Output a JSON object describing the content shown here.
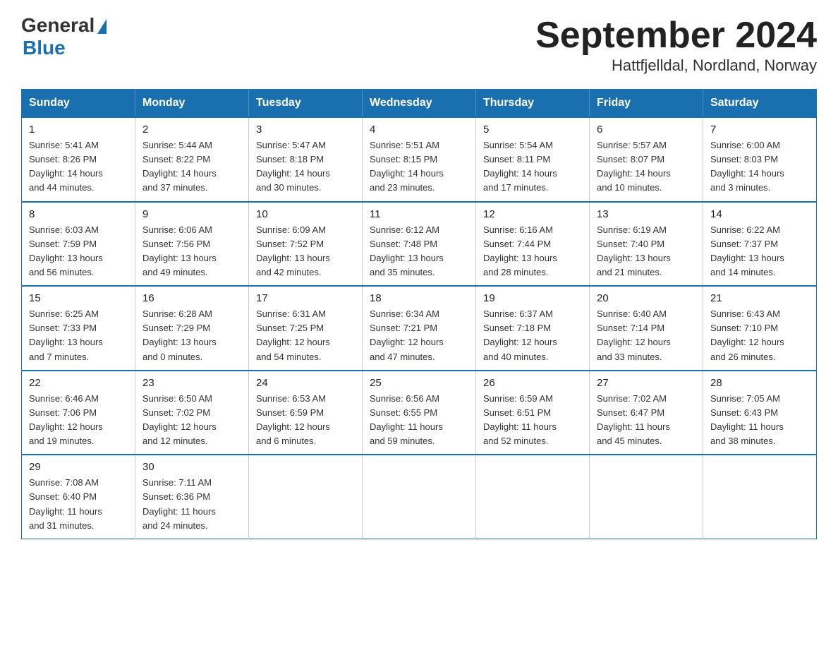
{
  "logo": {
    "general": "General",
    "blue": "Blue",
    "arrow": "▶"
  },
  "title": "September 2024",
  "subtitle": "Hattfjelldal, Nordland, Norway",
  "days_of_week": [
    "Sunday",
    "Monday",
    "Tuesday",
    "Wednesday",
    "Thursday",
    "Friday",
    "Saturday"
  ],
  "weeks": [
    [
      {
        "day": "1",
        "sunrise": "5:41 AM",
        "sunset": "8:26 PM",
        "daylight": "14 hours and 44 minutes."
      },
      {
        "day": "2",
        "sunrise": "5:44 AM",
        "sunset": "8:22 PM",
        "daylight": "14 hours and 37 minutes."
      },
      {
        "day": "3",
        "sunrise": "5:47 AM",
        "sunset": "8:18 PM",
        "daylight": "14 hours and 30 minutes."
      },
      {
        "day": "4",
        "sunrise": "5:51 AM",
        "sunset": "8:15 PM",
        "daylight": "14 hours and 23 minutes."
      },
      {
        "day": "5",
        "sunrise": "5:54 AM",
        "sunset": "8:11 PM",
        "daylight": "14 hours and 17 minutes."
      },
      {
        "day": "6",
        "sunrise": "5:57 AM",
        "sunset": "8:07 PM",
        "daylight": "14 hours and 10 minutes."
      },
      {
        "day": "7",
        "sunrise": "6:00 AM",
        "sunset": "8:03 PM",
        "daylight": "14 hours and 3 minutes."
      }
    ],
    [
      {
        "day": "8",
        "sunrise": "6:03 AM",
        "sunset": "7:59 PM",
        "daylight": "13 hours and 56 minutes."
      },
      {
        "day": "9",
        "sunrise": "6:06 AM",
        "sunset": "7:56 PM",
        "daylight": "13 hours and 49 minutes."
      },
      {
        "day": "10",
        "sunrise": "6:09 AM",
        "sunset": "7:52 PM",
        "daylight": "13 hours and 42 minutes."
      },
      {
        "day": "11",
        "sunrise": "6:12 AM",
        "sunset": "7:48 PM",
        "daylight": "13 hours and 35 minutes."
      },
      {
        "day": "12",
        "sunrise": "6:16 AM",
        "sunset": "7:44 PM",
        "daylight": "13 hours and 28 minutes."
      },
      {
        "day": "13",
        "sunrise": "6:19 AM",
        "sunset": "7:40 PM",
        "daylight": "13 hours and 21 minutes."
      },
      {
        "day": "14",
        "sunrise": "6:22 AM",
        "sunset": "7:37 PM",
        "daylight": "13 hours and 14 minutes."
      }
    ],
    [
      {
        "day": "15",
        "sunrise": "6:25 AM",
        "sunset": "7:33 PM",
        "daylight": "13 hours and 7 minutes."
      },
      {
        "day": "16",
        "sunrise": "6:28 AM",
        "sunset": "7:29 PM",
        "daylight": "13 hours and 0 minutes."
      },
      {
        "day": "17",
        "sunrise": "6:31 AM",
        "sunset": "7:25 PM",
        "daylight": "12 hours and 54 minutes."
      },
      {
        "day": "18",
        "sunrise": "6:34 AM",
        "sunset": "7:21 PM",
        "daylight": "12 hours and 47 minutes."
      },
      {
        "day": "19",
        "sunrise": "6:37 AM",
        "sunset": "7:18 PM",
        "daylight": "12 hours and 40 minutes."
      },
      {
        "day": "20",
        "sunrise": "6:40 AM",
        "sunset": "7:14 PM",
        "daylight": "12 hours and 33 minutes."
      },
      {
        "day": "21",
        "sunrise": "6:43 AM",
        "sunset": "7:10 PM",
        "daylight": "12 hours and 26 minutes."
      }
    ],
    [
      {
        "day": "22",
        "sunrise": "6:46 AM",
        "sunset": "7:06 PM",
        "daylight": "12 hours and 19 minutes."
      },
      {
        "day": "23",
        "sunrise": "6:50 AM",
        "sunset": "7:02 PM",
        "daylight": "12 hours and 12 minutes."
      },
      {
        "day": "24",
        "sunrise": "6:53 AM",
        "sunset": "6:59 PM",
        "daylight": "12 hours and 6 minutes."
      },
      {
        "day": "25",
        "sunrise": "6:56 AM",
        "sunset": "6:55 PM",
        "daylight": "11 hours and 59 minutes."
      },
      {
        "day": "26",
        "sunrise": "6:59 AM",
        "sunset": "6:51 PM",
        "daylight": "11 hours and 52 minutes."
      },
      {
        "day": "27",
        "sunrise": "7:02 AM",
        "sunset": "6:47 PM",
        "daylight": "11 hours and 45 minutes."
      },
      {
        "day": "28",
        "sunrise": "7:05 AM",
        "sunset": "6:43 PM",
        "daylight": "11 hours and 38 minutes."
      }
    ],
    [
      {
        "day": "29",
        "sunrise": "7:08 AM",
        "sunset": "6:40 PM",
        "daylight": "11 hours and 31 minutes."
      },
      {
        "day": "30",
        "sunrise": "7:11 AM",
        "sunset": "6:36 PM",
        "daylight": "11 hours and 24 minutes."
      },
      null,
      null,
      null,
      null,
      null
    ]
  ],
  "labels": {
    "sunrise": "Sunrise:",
    "sunset": "Sunset:",
    "daylight": "Daylight:"
  }
}
